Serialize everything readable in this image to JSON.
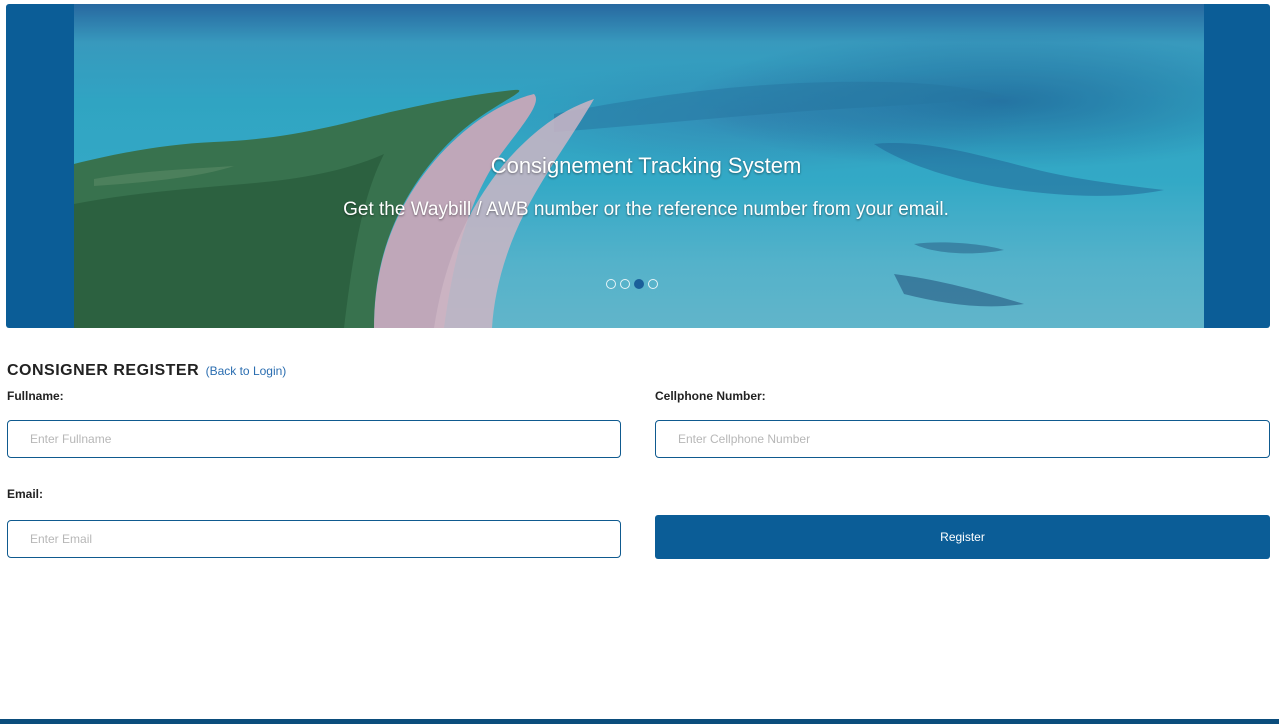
{
  "banner": {
    "title": "Consignement Tracking System",
    "text": "Get the Waybill / AWB number or the reference number from your email.",
    "slides": 4,
    "active_slide": 3,
    "accent_color": "#0b5d97"
  },
  "form": {
    "title": "CONSIGNER REGISTER",
    "back_link": "(Back to Login)",
    "fullname": {
      "label": "Fullname:",
      "placeholder": "Enter Fullname",
      "value": ""
    },
    "cellphone": {
      "label": "Cellphone Number:",
      "placeholder": "Enter Cellphone Number",
      "value": ""
    },
    "email": {
      "label": "Email:",
      "placeholder": "Enter Email",
      "value": ""
    },
    "register_button": "Register"
  }
}
